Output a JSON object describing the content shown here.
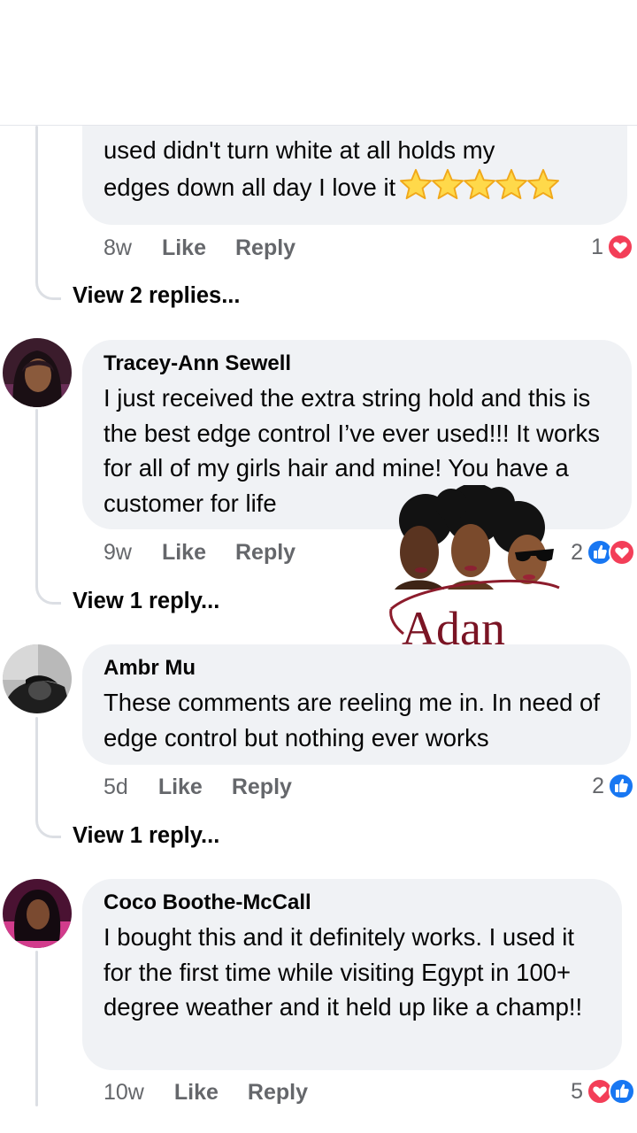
{
  "comments": [
    {
      "text_lines": [
        "used didn't turn white at all holds my",
        "edges down  all day I love it"
      ],
      "time": "8w",
      "like": "Like",
      "reply": "Reply",
      "reactions": {
        "count": "1",
        "icons": [
          "love-icon"
        ]
      },
      "view_replies": "View 2 replies..."
    },
    {
      "author": "Tracey-Ann Sewell",
      "text": "I just received the extra string hold and this is the best edge control I’ve ever used!!! It works for all of my girls hair and mine! You have a customer for life",
      "time": "9w",
      "like": "Like",
      "reply": "Reply",
      "reactions": {
        "count": "2",
        "icons": [
          "like-icon",
          "love-icon"
        ]
      },
      "view_replies": "View 1 reply..."
    },
    {
      "author": "Ambr Mu",
      "text": "These comments are reeling me in. In need of edge control but nothing ever works",
      "time": "5d",
      "like": "Like",
      "reply": "Reply",
      "reactions": {
        "count": "2",
        "icons": [
          "like-icon"
        ]
      },
      "view_replies": "View 1 reply..."
    },
    {
      "author": "Coco Boothe-McCall",
      "text": "I bought this and it definitely works. I used it for the first time while visiting Egypt in 100+ degree weather and it held up like a champ!!",
      "time": "10w",
      "like": "Like",
      "reply": "Reply",
      "reactions": {
        "count": "5",
        "icons": [
          "love-icon",
          "like-icon"
        ]
      }
    }
  ],
  "star_rating": 5,
  "watermark": {
    "brand": "Adan"
  },
  "colors": {
    "bubble": "#f0f2f5",
    "meta_text": "#65676b",
    "like_blue": "#1877f2",
    "love_red": "#f33e58",
    "thread_line": "#dcdfe4"
  }
}
